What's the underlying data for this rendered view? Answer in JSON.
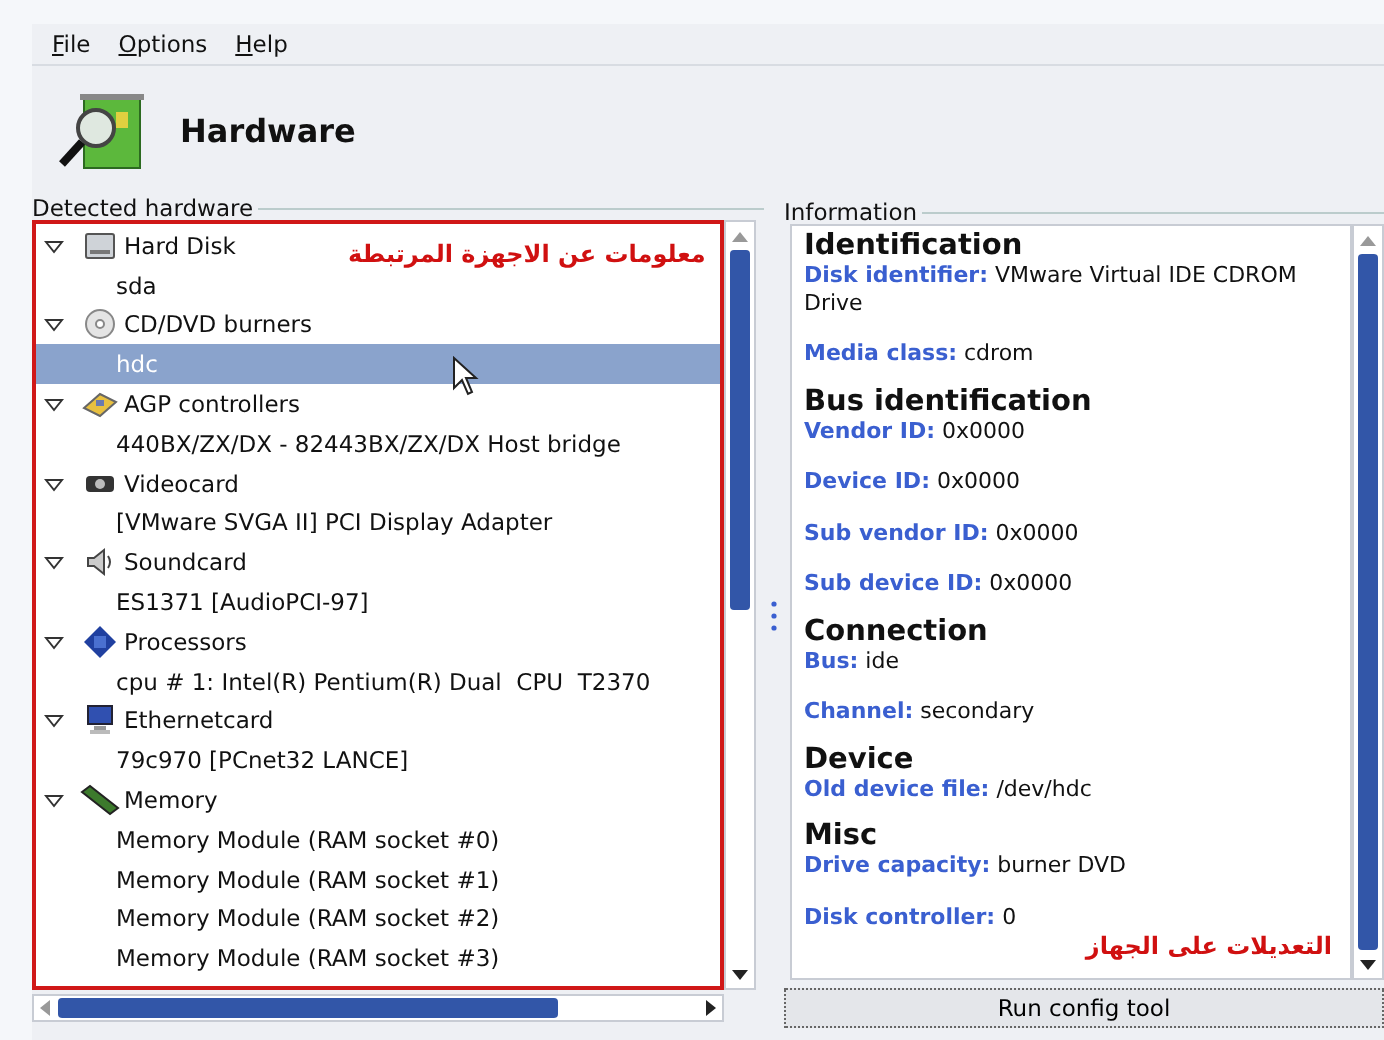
{
  "menu": [
    {
      "label": "File"
    },
    {
      "label": "Options"
    },
    {
      "label": "Help"
    }
  ],
  "title": "Hardware",
  "detected": {
    "legend": "Detected hardware",
    "annotation": "معلومات عن الاجهزة المرتبطة",
    "tree": [
      {
        "label": "Hard Disk",
        "expanded": true,
        "children": [
          {
            "label": "sda",
            "selected": false
          }
        ]
      },
      {
        "label": "CD/DVD burners",
        "expanded": true,
        "children": [
          {
            "label": "hdc",
            "selected": true
          }
        ]
      },
      {
        "label": "AGP controllers",
        "expanded": true,
        "children": [
          {
            "label": "440BX/ZX/DX - 82443BX/ZX/DX Host bridge",
            "selected": false
          }
        ]
      },
      {
        "label": "Videocard",
        "expanded": true,
        "children": [
          {
            "label": "[VMware SVGA II] PCI Display Adapter",
            "selected": false
          }
        ]
      },
      {
        "label": "Soundcard",
        "expanded": true,
        "children": [
          {
            "label": "ES1371 [AudioPCI-97]",
            "selected": false
          }
        ]
      },
      {
        "label": "Processors",
        "expanded": true,
        "children": [
          {
            "label": "cpu # 1: Intel(R) Pentium(R) Dual  CPU  T2370",
            "selected": false
          }
        ]
      },
      {
        "label": "Ethernetcard",
        "expanded": true,
        "children": [
          {
            "label": "79c970 [PCnet32 LANCE]",
            "selected": false
          }
        ]
      },
      {
        "label": "Memory",
        "expanded": true,
        "children": [
          {
            "label": "Memory Module (RAM socket #0)",
            "selected": false
          },
          {
            "label": "Memory Module (RAM socket #1)",
            "selected": false
          },
          {
            "label": "Memory Module (RAM socket #2)",
            "selected": false
          },
          {
            "label": "Memory Module (RAM socket #3)",
            "selected": false
          }
        ]
      }
    ]
  },
  "information": {
    "legend": "Information",
    "sections": [
      {
        "heading": "Identification",
        "fields": [
          {
            "label": "Disk identifier:",
            "value": "VMware Virtual IDE CDROM Drive"
          },
          {
            "label": "Media class:",
            "value": "cdrom"
          }
        ]
      },
      {
        "heading": "Bus identification",
        "fields": [
          {
            "label": "Vendor ID:",
            "value": "0x0000"
          },
          {
            "label": "Device ID:",
            "value": "0x0000"
          },
          {
            "label": "Sub vendor ID:",
            "value": "0x0000"
          },
          {
            "label": "Sub device ID:",
            "value": "0x0000"
          }
        ]
      },
      {
        "heading": "Connection",
        "fields": [
          {
            "label": "Bus:",
            "value": "ide"
          },
          {
            "label": "Channel:",
            "value": "secondary"
          }
        ]
      },
      {
        "heading": "Device",
        "fields": [
          {
            "label": "Old device file:",
            "value": "/dev/hdc"
          }
        ]
      },
      {
        "heading": "Misc",
        "fields": [
          {
            "label": "Drive capacity:",
            "value": "burner DVD"
          },
          {
            "label": "Disk controller:",
            "value": "0"
          }
        ]
      }
    ],
    "annotation": "التعديلات على الجهاز",
    "button": "Run config tool"
  }
}
